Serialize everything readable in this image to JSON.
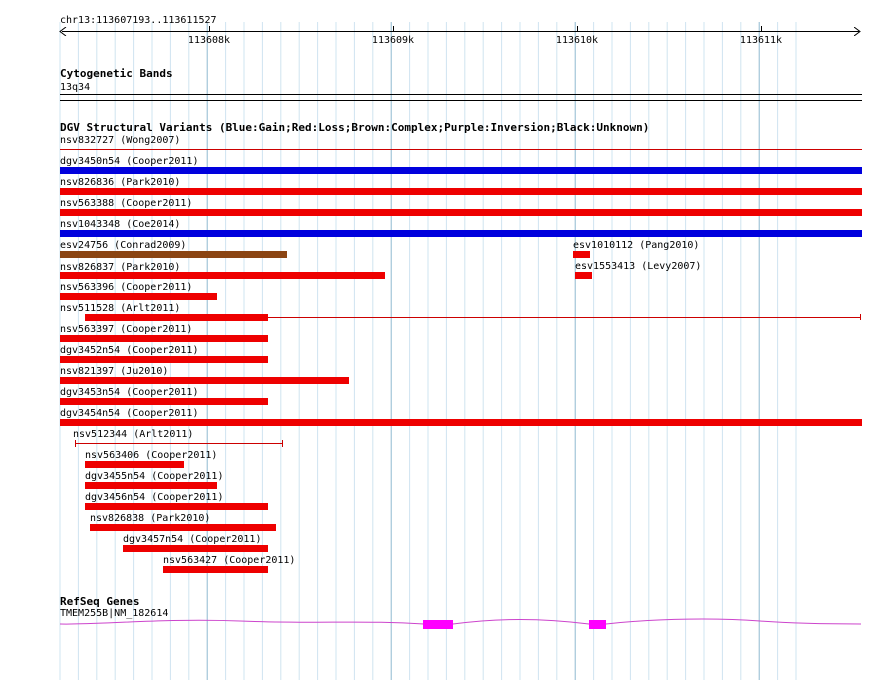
{
  "location": "chr13:113607193..113611527",
  "ruler": {
    "labels": [
      "113608k",
      "113609k",
      "113610k",
      "113611k"
    ]
  },
  "tracks": {
    "cytoband": {
      "title": "Cytogenetic Bands",
      "band": "13q34"
    },
    "dgv": {
      "title": "DGV Structural Variants (Blue:Gain;Red:Loss;Brown:Complex;Purple:Inversion;Black:Unknown)",
      "colors": {
        "gain": "#0000dd",
        "loss": "#ee0000",
        "complex": "#8b4513",
        "line": "#cc0000"
      },
      "features": [
        {
          "label": "nsv832727 (Wong2007)"
        },
        {
          "label": "dgv3450n54 (Cooper2011)"
        },
        {
          "label": "nsv826836 (Park2010)"
        },
        {
          "label": "nsv563388 (Cooper2011)"
        },
        {
          "label": "nsv1043348 (Coe2014)"
        },
        {
          "label": "esv24756 (Conrad2009)"
        },
        {
          "label": "esv1010112 (Pang2010)"
        },
        {
          "label": "nsv826837 (Park2010)"
        },
        {
          "label": "esv1553413 (Levy2007)"
        },
        {
          "label": "nsv563396 (Cooper2011)"
        },
        {
          "label": "nsv511528 (Arlt2011)"
        },
        {
          "label": "nsv563397 (Cooper2011)"
        },
        {
          "label": "dgv3452n54 (Cooper2011)"
        },
        {
          "label": "nsv821397 (Ju2010)"
        },
        {
          "label": "dgv3453n54 (Cooper2011)"
        },
        {
          "label": "dgv3454n54 (Cooper2011)"
        },
        {
          "label": "nsv512344 (Arlt2011)"
        },
        {
          "label": "nsv563406 (Cooper2011)"
        },
        {
          "label": "dgv3455n54 (Cooper2011)"
        },
        {
          "label": "dgv3456n54 (Cooper2011)"
        },
        {
          "label": "nsv826838 (Park2010)"
        },
        {
          "label": "dgv3457n54 (Cooper2011)"
        },
        {
          "label": "nsv563427 (Cooper2011)"
        }
      ]
    },
    "refseq": {
      "title": "RefSeq Genes",
      "gene": "TMEM255B|NM_182614",
      "color": "#ff00ff"
    }
  }
}
